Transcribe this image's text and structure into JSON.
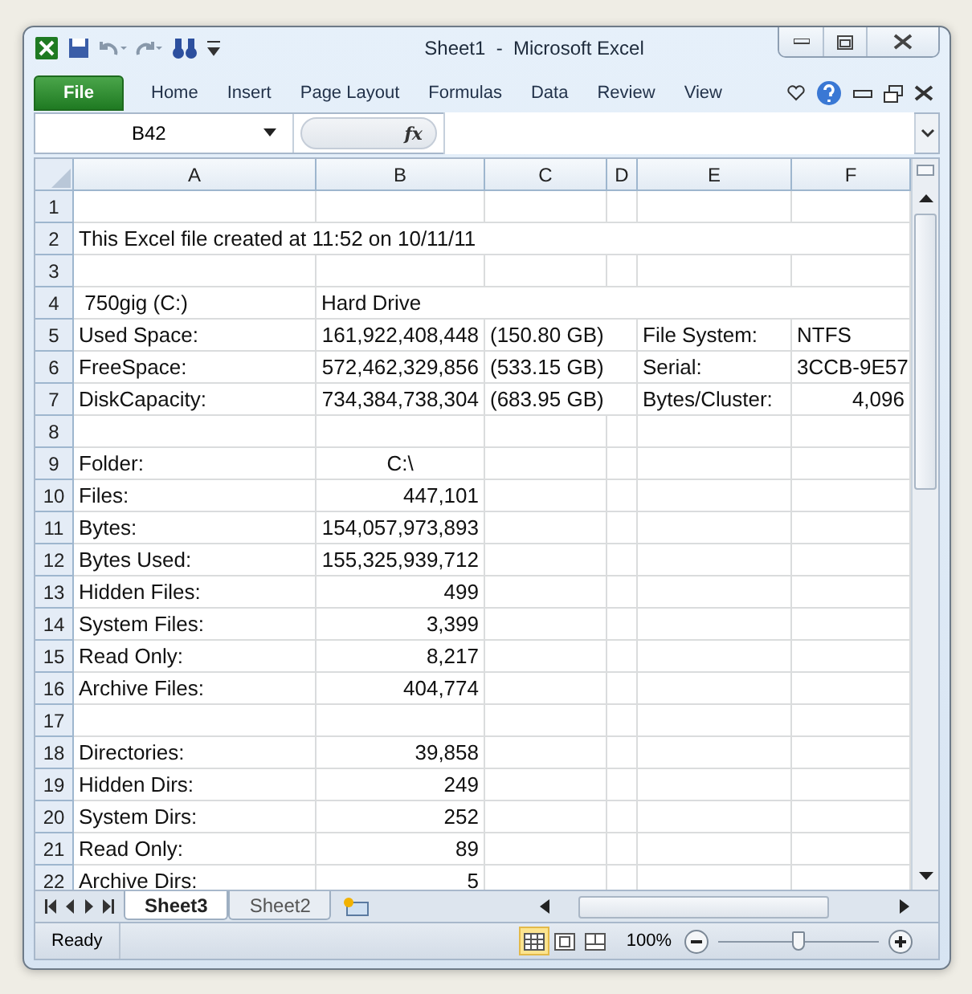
{
  "window": {
    "title": "Sheet1  -  Microsoft Excel"
  },
  "ribbon": {
    "file_tab": "File",
    "tabs": [
      "Home",
      "Insert",
      "Page Layout",
      "Formulas",
      "Data",
      "Review",
      "View"
    ]
  },
  "formula_bar": {
    "name_box": "B42",
    "fx": "fx"
  },
  "columns": [
    "A",
    "B",
    "C",
    "D",
    "E",
    "F"
  ],
  "rows": [
    {
      "number": "1",
      "cells": {}
    },
    {
      "number": "2",
      "cells": {
        "A": {
          "t": "This Excel file created at 11:52 on 10/11/11",
          "kind": "text"
        }
      }
    },
    {
      "number": "3",
      "cells": {}
    },
    {
      "number": "4",
      "cells": {
        "A": {
          "t": " 750gig (C:)",
          "kind": "text"
        },
        "B": {
          "t": "Hard Drive",
          "kind": "text"
        }
      }
    },
    {
      "number": "5",
      "cells": {
        "A": {
          "t": "Used Space:",
          "kind": "text"
        },
        "B": {
          "t": "161,922,408,448",
          "kind": "number"
        },
        "C": {
          "t": "(150.80 GB)",
          "kind": "text"
        },
        "E": {
          "t": "File System:"
        },
        "F": {
          "t": "NTFS",
          "kind": "text"
        }
      }
    },
    {
      "number": "6",
      "cells": {
        "A": {
          "t": "FreeSpace:",
          "kind": "text"
        },
        "B": {
          "t": "572,462,329,856",
          "kind": "number"
        },
        "C": {
          "t": "(533.15 GB)",
          "kind": "text"
        },
        "E": {
          "t": "Serial:"
        },
        "F": {
          "t": "3CCB-9E57",
          "kind": "text"
        }
      }
    },
    {
      "number": "7",
      "cells": {
        "A": {
          "t": "DiskCapacity:",
          "kind": "text"
        },
        "B": {
          "t": "734,384,738,304",
          "kind": "number"
        },
        "C": {
          "t": "(683.95 GB)",
          "kind": "text"
        },
        "E": {
          "t": "Bytes/Cluster:"
        },
        "F": {
          "t": "4,096",
          "kind": "number"
        }
      }
    },
    {
      "number": "8",
      "cells": {}
    },
    {
      "number": "9",
      "cells": {
        "A": {
          "t": "Folder:",
          "kind": "text"
        },
        "B": {
          "t": "C:\\",
          "kind": "centered"
        }
      }
    },
    {
      "number": "10",
      "cells": {
        "A": {
          "t": "Files:",
          "kind": "text"
        },
        "B": {
          "t": "447,101",
          "kind": "number"
        }
      }
    },
    {
      "number": "11",
      "cells": {
        "A": {
          "t": "Bytes:",
          "kind": "text"
        },
        "B": {
          "t": "154,057,973,893",
          "kind": "number"
        }
      }
    },
    {
      "number": "12",
      "cells": {
        "A": {
          "t": "Bytes Used:",
          "kind": "text"
        },
        "B": {
          "t": "155,325,939,712",
          "kind": "number"
        }
      }
    },
    {
      "number": "13",
      "cells": {
        "A": {
          "t": "Hidden Files:",
          "kind": "text"
        },
        "B": {
          "t": "499",
          "kind": "number"
        }
      }
    },
    {
      "number": "14",
      "cells": {
        "A": {
          "t": "System Files:",
          "kind": "text"
        },
        "B": {
          "t": "3,399",
          "kind": "number"
        }
      }
    },
    {
      "number": "15",
      "cells": {
        "A": {
          "t": "Read Only:",
          "kind": "text"
        },
        "B": {
          "t": "8,217",
          "kind": "number"
        }
      }
    },
    {
      "number": "16",
      "cells": {
        "A": {
          "t": "Archive Files:",
          "kind": "text"
        },
        "B": {
          "t": "404,774",
          "kind": "number"
        }
      }
    },
    {
      "number": "17",
      "cells": {}
    },
    {
      "number": "18",
      "cells": {
        "A": {
          "t": "Directories:",
          "kind": "text"
        },
        "B": {
          "t": "39,858",
          "kind": "number"
        }
      }
    },
    {
      "number": "19",
      "cells": {
        "A": {
          "t": "Hidden Dirs:",
          "kind": "text"
        },
        "B": {
          "t": "249",
          "kind": "number"
        }
      }
    },
    {
      "number": "20",
      "cells": {
        "A": {
          "t": "System Dirs:",
          "kind": "text"
        },
        "B": {
          "t": "252",
          "kind": "number"
        }
      }
    },
    {
      "number": "21",
      "cells": {
        "A": {
          "t": "Read Only:",
          "kind": "text"
        },
        "B": {
          "t": "89",
          "kind": "number"
        }
      }
    },
    {
      "number": "22",
      "cells": {
        "A": {
          "t": "Archive Dirs:",
          "kind": "text"
        },
        "B": {
          "t": "5",
          "kind": "number"
        }
      }
    }
  ],
  "sheet_tabs": [
    {
      "label": "Sheet3",
      "selected": true
    },
    {
      "label": "Sheet2",
      "selected": false
    }
  ],
  "status_bar": {
    "status": "Ready",
    "views": [
      {
        "kind": "normal",
        "selected": true
      },
      {
        "kind": "layout",
        "selected": false
      },
      {
        "kind": "break",
        "selected": false
      }
    ],
    "zoom": "100%",
    "zoom_slider": {
      "level": 0.5
    }
  }
}
